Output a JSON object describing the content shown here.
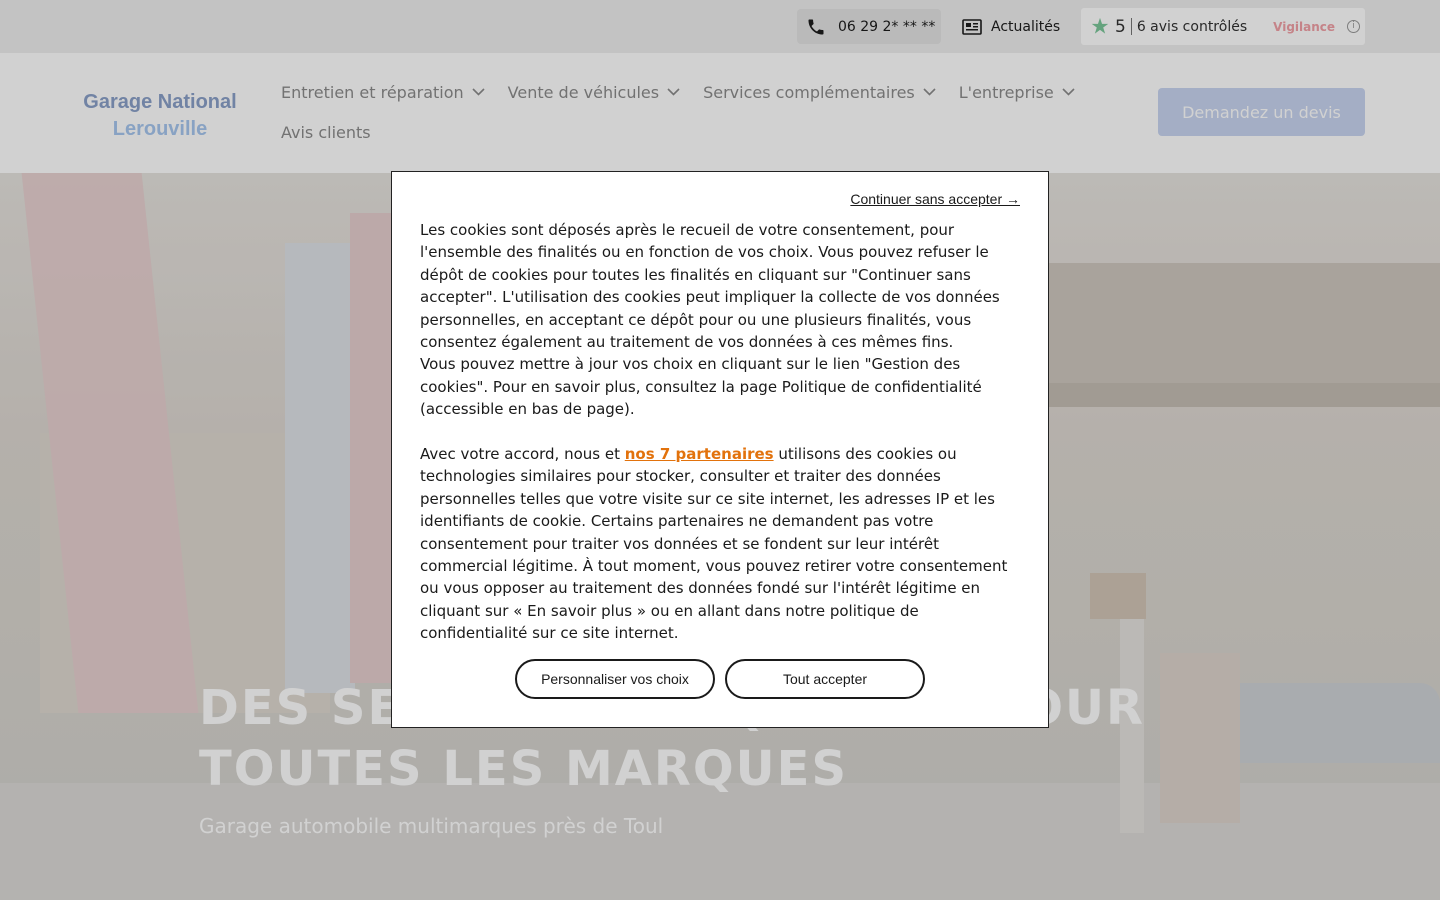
{
  "topbar": {
    "phone": "06 29 2* ** **",
    "news_label": "Actualités",
    "reviews": {
      "score": "5",
      "count": "6 avis contrôlés",
      "badge": "Vigilance",
      "info": "i"
    }
  },
  "header": {
    "logo_line1": "Garage National",
    "logo_line2": "Lerouville",
    "nav": [
      {
        "label": "Entretien et réparation"
      },
      {
        "label": "Vente de véhicules"
      },
      {
        "label": "Services complémentaires"
      },
      {
        "label": "L'entreprise"
      },
      {
        "label": "Avis clients"
      }
    ],
    "cta": "Demandez un devis"
  },
  "hero": {
    "title": "DES SERVICES DE QUALITÉ POUR TOUTES LES MARQUES",
    "subtitle": "Garage automobile multimarques près de Toul"
  },
  "cookie": {
    "skip": "Continuer sans accepter →",
    "p1": "Les cookies sont déposés après le recueil de votre consentement, pour l'ensemble des finalités ou en fonction de vos choix. Vous pouvez refuser le dépôt de cookies pour toutes les finalités en cliquant sur \"Continuer sans accepter\". L'utilisation des cookies peut impliquer la collecte de vos données personnelles, en acceptant ce dépôt pour ou une plusieurs finalités, vous consentez également au traitement de vos données à ces mêmes fins.",
    "p2": "Vous pouvez mettre à jour vos choix en cliquant sur le lien \"Gestion des cookies\". Pour en savoir plus, consultez la page Politique de confidentialité (accessible en bas de page).",
    "p3_start": "Avec votre accord, nous et ",
    "partners_link": "nos 7 partenaires",
    "p3_end": " utilisons des cookies ou technologies similaires pour stocker, consulter et traiter des données personnelles telles que votre visite sur ce site internet, les adresses IP et les identifiants de cookie. Certains partenaires ne demandent pas votre consentement pour traiter vos données et se fondent sur leur intérêt commercial légitime. À tout moment, vous pouvez retirer votre consentement ou vous opposer au traitement des données fondé sur l'intérêt légitime en cliquant sur « En savoir plus » ou en allant dans notre politique de confidentialité sur ce site internet.",
    "btn_customize": "Personnaliser vos choix",
    "btn_accept": "Tout accepter"
  },
  "colors": {
    "accent": "#e2720c",
    "cta_bg": "#c8d5f1",
    "badge": "#f1a0a6"
  },
  "icons": {
    "phone": "phone-icon",
    "news": "newspaper-icon",
    "review": "star-icon",
    "info": "info-icon",
    "chevron": "chevron-down-icon"
  }
}
